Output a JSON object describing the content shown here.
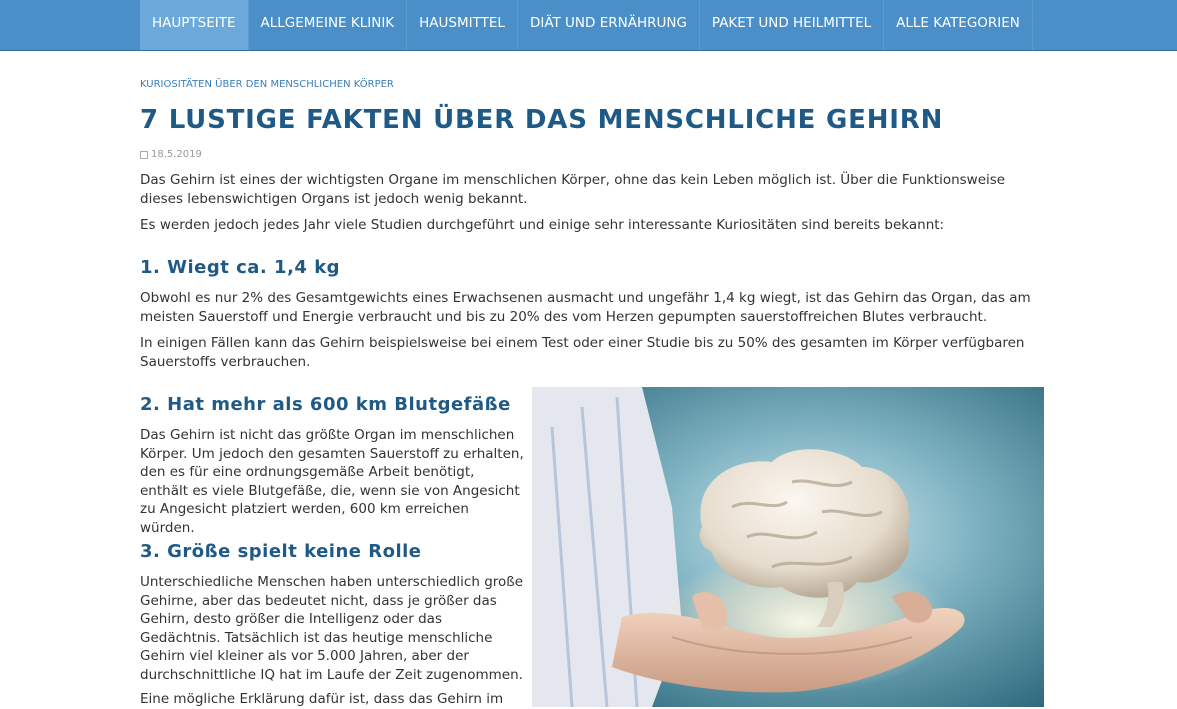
{
  "nav": {
    "items": [
      {
        "label": "HAUPTSEITE",
        "active": true
      },
      {
        "label": "ALLGEMEINE KLINIK",
        "active": false
      },
      {
        "label": "HAUSMITTEL",
        "active": false
      },
      {
        "label": "DIÄT UND ERNÄHRUNG",
        "active": false
      },
      {
        "label": "PAKET UND HEILMITTEL",
        "active": false
      },
      {
        "label": "ALLE KATEGORIEN",
        "active": false
      }
    ]
  },
  "article": {
    "category": "KURIOSITÄTEN ÜBER DEN MENSCHLICHEN KÖRPER",
    "title": "7 LUSTIGE FAKTEN ÜBER DAS MENSCHLICHE GEHIRN",
    "date": "18.5.2019",
    "intro": [
      "Das Gehirn ist eines der wichtigsten Organe im menschlichen Körper, ohne das kein Leben möglich ist. Über die Funktionsweise dieses lebenswichtigen Organs ist jedoch wenig bekannt.",
      "Es werden jedoch jedes Jahr viele Studien durchgeführt und einige sehr interessante Kuriositäten sind bereits bekannt:"
    ],
    "sections": [
      {
        "heading": "1. Wiegt ca. 1,4 kg",
        "paragraphs": [
          "Obwohl es nur 2% des Gesamtgewichts eines Erwachsenen ausmacht und ungefähr 1,4 kg wiegt, ist das Gehirn das Organ, das am meisten Sauerstoff und Energie verbraucht und bis zu 20% des vom Herzen gepumpten sauerstoffreichen Blutes verbraucht.",
          "In einigen Fällen kann das Gehirn beispielsweise bei einem Test oder einer Studie bis zu 50% des gesamten im Körper verfügbaren Sauerstoffs verbrauchen."
        ]
      },
      {
        "heading": "2. Hat mehr als 600 km Blutgefäße",
        "paragraphs": [
          "Das Gehirn ist nicht das größte Organ im menschlichen Körper. Um jedoch den gesamten Sauerstoff zu erhalten, den es für eine ordnungsgemäße Arbeit benötigt, enthält es viele Blutgefäße, die, wenn sie von Angesicht zu Angesicht platziert werden, 600 km erreichen würden."
        ]
      },
      {
        "heading": "3. Größe spielt keine Rolle",
        "paragraphs": [
          "Unterschiedliche Menschen haben unterschiedlich große Gehirne, aber das bedeutet nicht, dass je größer das Gehirn, desto größer die Intelligenz oder das Gedächtnis. Tatsächlich ist das heutige menschliche Gehirn viel kleiner als vor 5.000 Jahren, aber der durchschnittliche IQ hat im Laufe der Zeit zugenommen."
        ]
      }
    ],
    "cutoff_text": "Eine mögliche Erklärung dafür ist, dass das Gehirn im"
  },
  "colors": {
    "nav_bg": "#4a8fc7",
    "nav_active": "#6aa9da",
    "heading": "#1f5a87",
    "category": "#3a7eb8"
  }
}
